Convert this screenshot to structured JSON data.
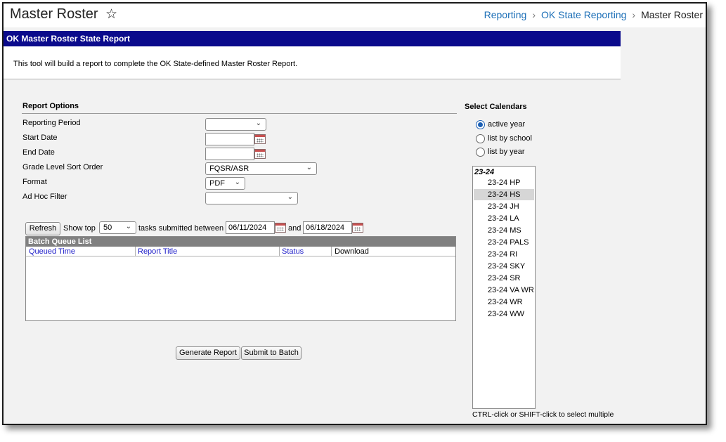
{
  "page": {
    "title": "Master Roster",
    "breadcrumb": [
      "Reporting",
      "OK State Reporting",
      "Master Roster"
    ]
  },
  "report": {
    "header": "OK Master Roster State Report",
    "description": "This tool will build a report to complete the OK State-defined Master Roster Report."
  },
  "options": {
    "section_title": "Report Options",
    "reporting_period_label": "Reporting Period",
    "reporting_period_value": "",
    "start_date_label": "Start Date",
    "start_date_value": "",
    "end_date_label": "End Date",
    "end_date_value": "",
    "grade_sort_label": "Grade Level Sort Order",
    "grade_sort_value": "FQSR/ASR",
    "format_label": "Format",
    "format_value": "PDF",
    "adhoc_label": "Ad Hoc Filter",
    "adhoc_value": ""
  },
  "batch": {
    "refresh_label": "Refresh",
    "show_top_label": "Show top",
    "show_top_value": "50",
    "submitted_between_label": "tasks submitted between",
    "from_date": "06/11/2024",
    "and_label": "and",
    "to_date": "06/18/2024",
    "list_title": "Batch Queue List",
    "columns": [
      "Queued Time",
      "Report Title",
      "Status",
      "Download"
    ]
  },
  "actions": {
    "generate_label": "Generate Report",
    "submit_label": "Submit to Batch"
  },
  "calendars": {
    "title": "Select Calendars",
    "radios": [
      {
        "label": "active year",
        "checked": true
      },
      {
        "label": "list by school",
        "checked": false
      },
      {
        "label": "list by year",
        "checked": false
      }
    ],
    "group": "23-24",
    "items": [
      "23-24 HP",
      "23-24 HS",
      "23-24 JH",
      "23-24 LA",
      "23-24 MS",
      "23-24 PALS",
      "23-24 RI",
      "23-24 SKY",
      "23-24 SR",
      "23-24 VA WR",
      "23-24 WR",
      "23-24 WW"
    ],
    "selected_index": 1,
    "hint": "CTRL-click or SHIFT-click to select multiple"
  },
  "icons": {
    "favorite": "star-outline-icon",
    "calendar": "calendar-icon",
    "dropdown": "chevron-down-icon"
  },
  "colors": {
    "header_bg": "#0b0b8c",
    "link": "#1c6fb7",
    "column_link": "#1c1cc8",
    "radio_accent": "#1a5fb4"
  }
}
